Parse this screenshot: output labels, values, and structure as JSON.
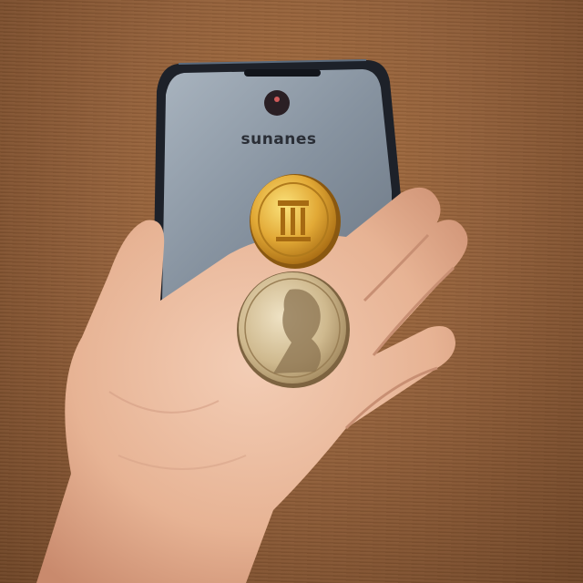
{
  "phone": {
    "brand_text": "sunanes"
  },
  "icons": {
    "phone_logo": "circle-logo-icon",
    "coin_front": "gold-coin-icon",
    "coin_back": "portrait-coin-icon"
  },
  "colors": {
    "table": "#93603a",
    "phone_screen": "#8e9aa7",
    "phone_frame": "#1d2129",
    "gold_coin": "#d9a233",
    "silver_coin": "#c9b48e",
    "skin": "#e9b99c"
  }
}
